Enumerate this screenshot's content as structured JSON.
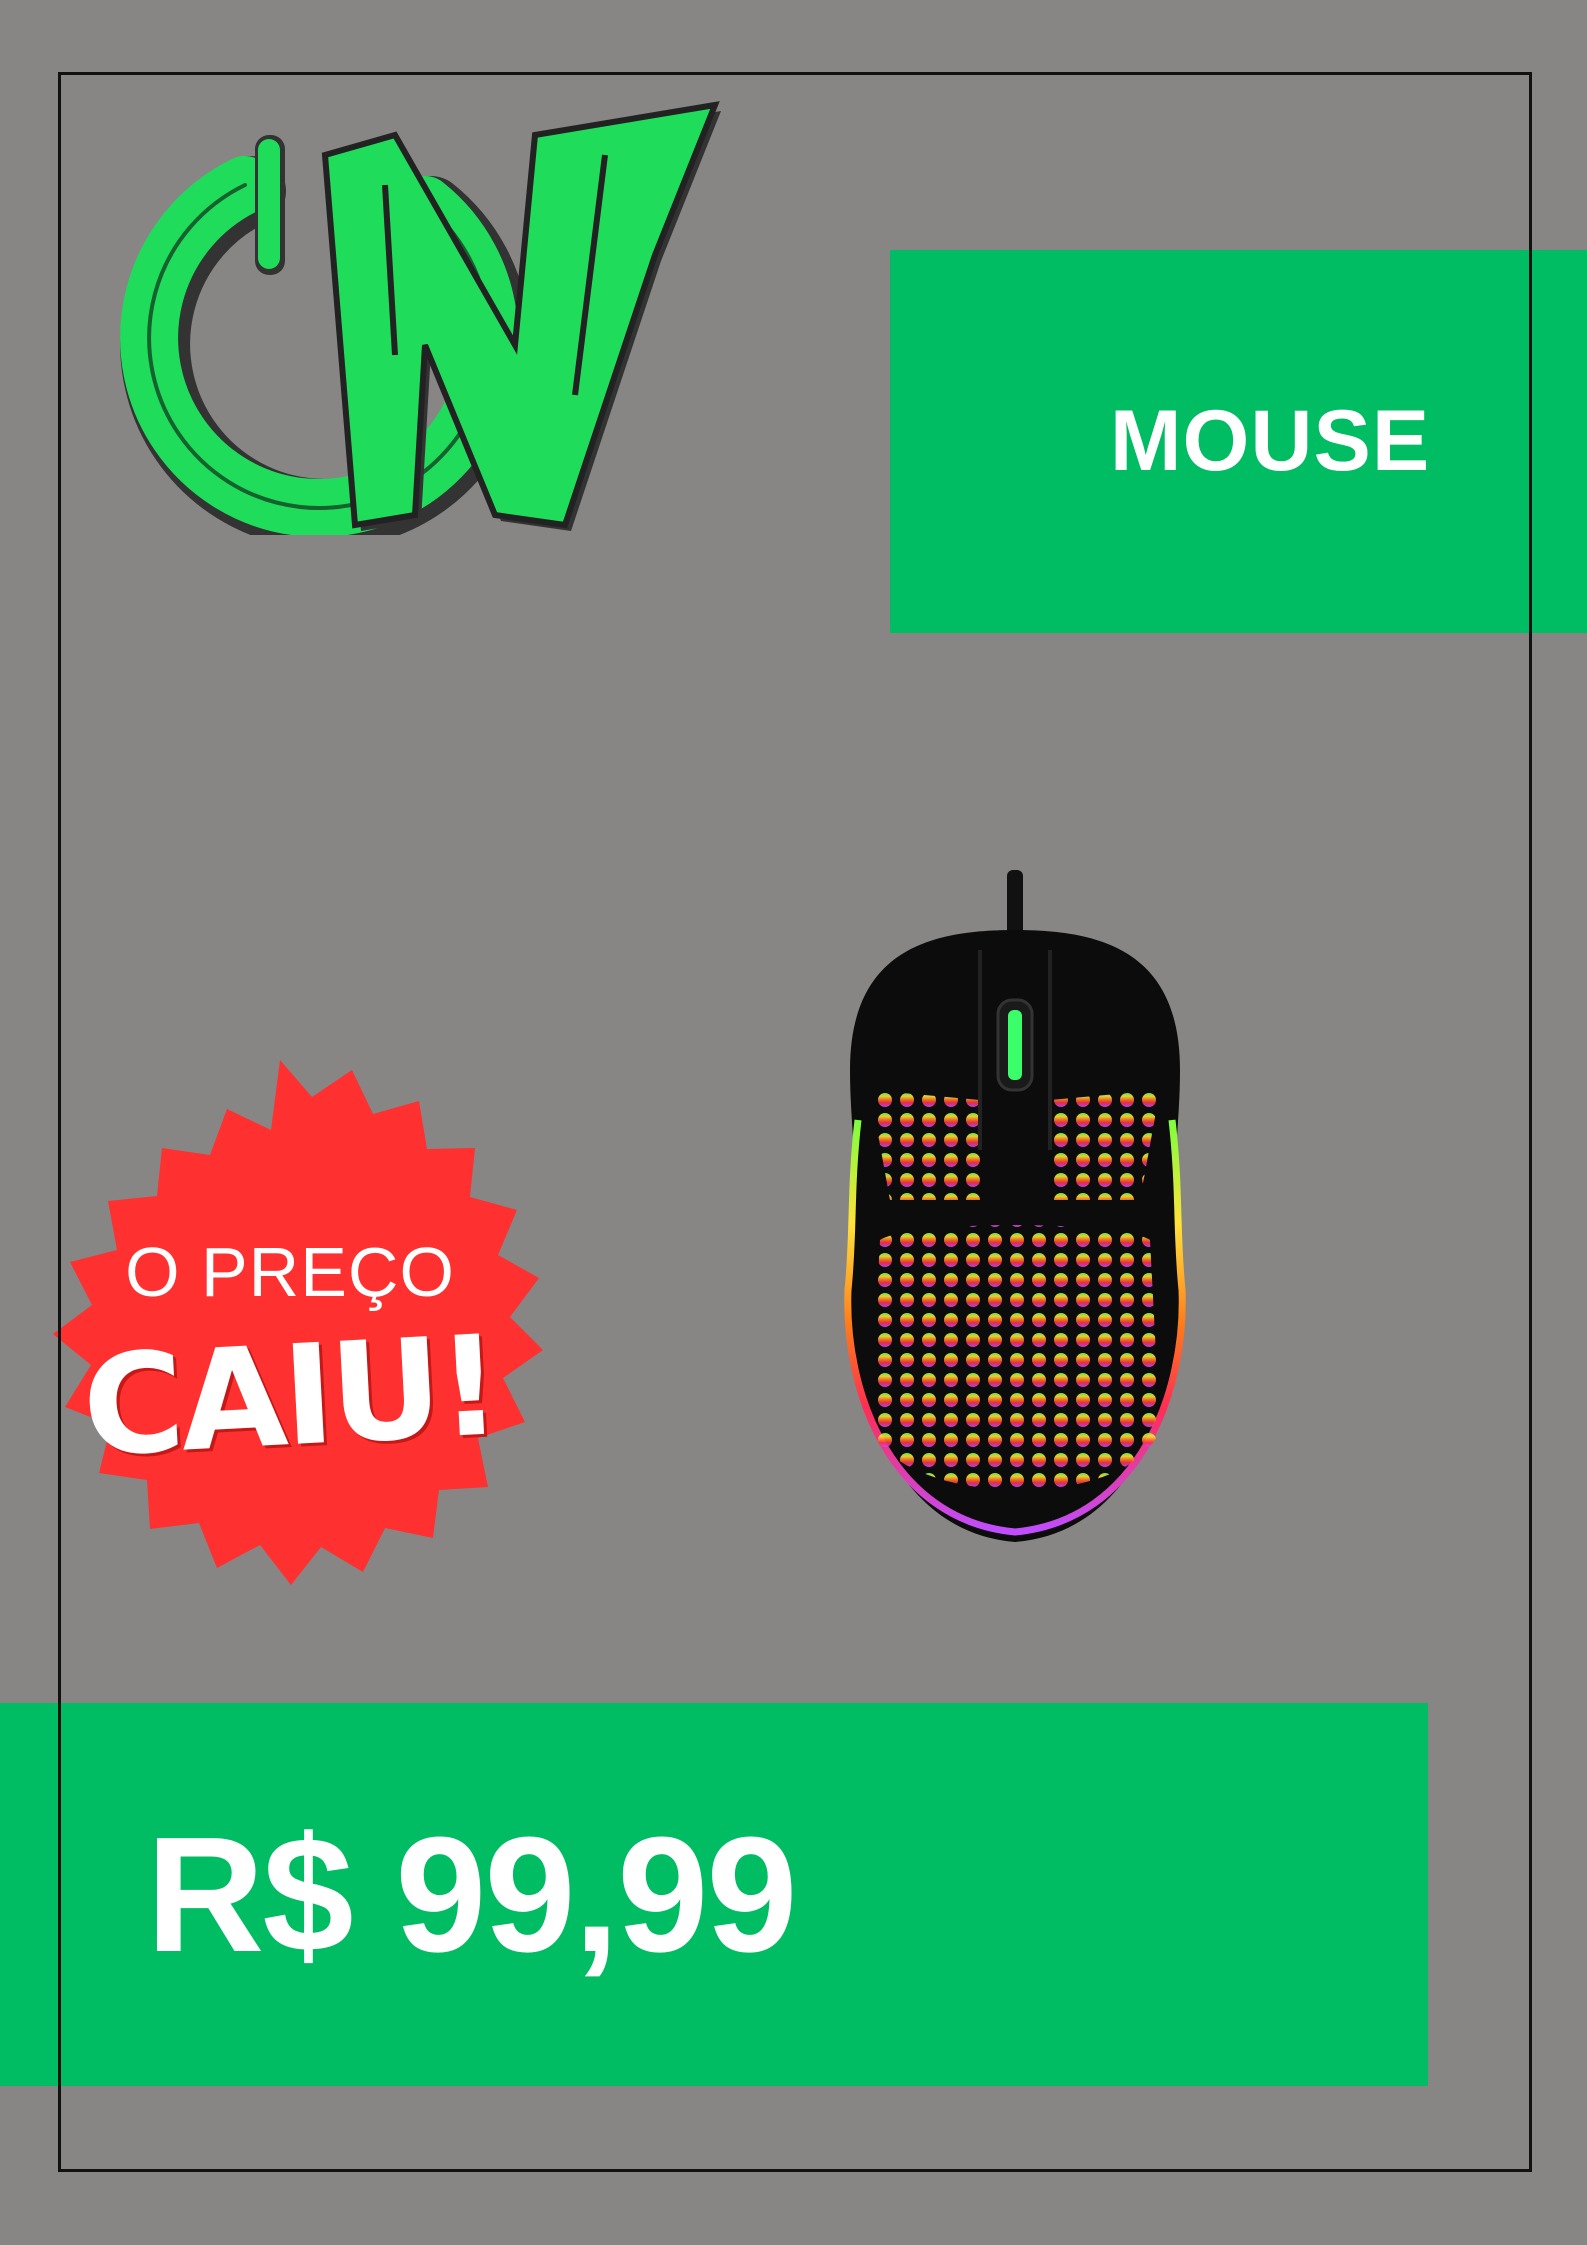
{
  "logo": {
    "name": "ON"
  },
  "category": {
    "label": "MOUSE"
  },
  "product": {
    "name": "mouse"
  },
  "badge": {
    "line1": "O PREÇO",
    "line2": "CAIU!"
  },
  "price": {
    "label": "R$ 99,99"
  },
  "colors": {
    "background": "#878685",
    "accent_green": "#00bc63",
    "badge_red": "#ff3030",
    "logo_green": "#1fdd5a"
  }
}
